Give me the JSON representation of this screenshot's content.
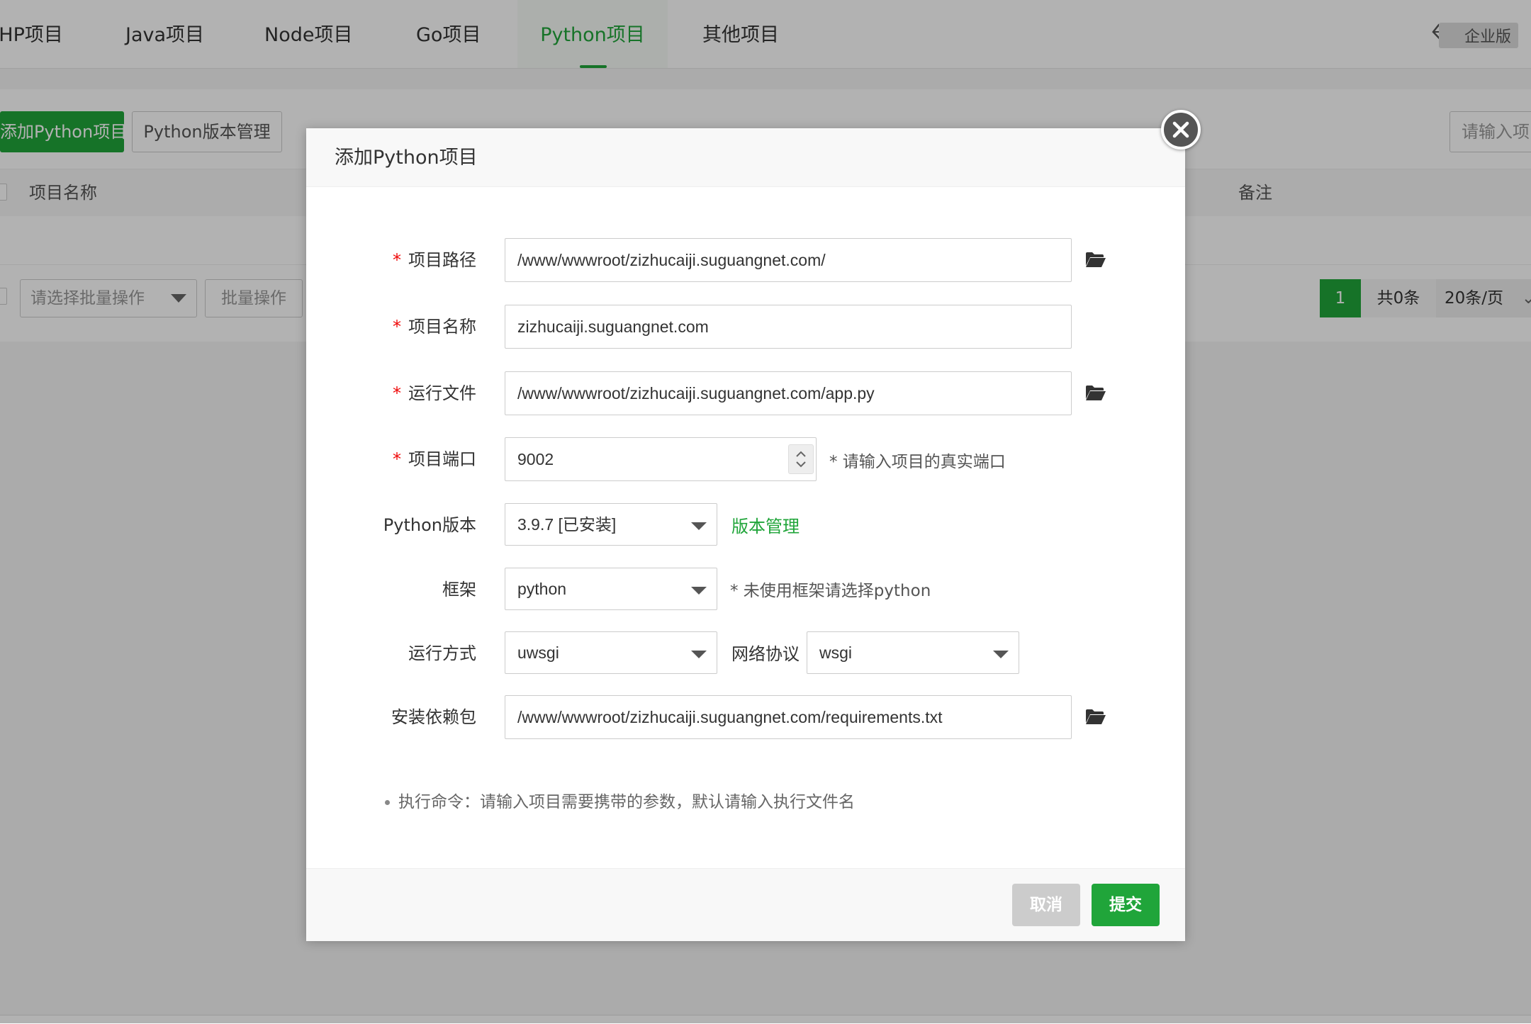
{
  "tabs": [
    {
      "label": "PHP项目",
      "active": false
    },
    {
      "label": "Java项目",
      "active": false
    },
    {
      "label": "Node项目",
      "active": false
    },
    {
      "label": "Go项目",
      "active": false
    },
    {
      "label": "Python项目",
      "active": true
    },
    {
      "label": "其他项目",
      "active": false
    }
  ],
  "enterprise_label": "企业版",
  "toolbar": {
    "add_label": "添加Python项目",
    "version_label": "Python版本管理",
    "search_placeholder": "请输入项"
  },
  "table": {
    "columns": [
      "项目名称",
      "备注"
    ],
    "batch_placeholder": "请选择批量操作",
    "batch_button": "批量操作"
  },
  "pager": {
    "current": "1",
    "total": "共0条",
    "page_size": "20条/页"
  },
  "colors": {
    "accent": "#20a53a",
    "required": "#ef0808"
  },
  "modal": {
    "title": "添加Python项目",
    "fields": {
      "path": {
        "label": "项目路径",
        "required": true,
        "value": "/www/wwwroot/zizhucaiji.suguangnet.com/"
      },
      "name": {
        "label": "项目名称",
        "required": true,
        "value": "zizhucaiji.suguangnet.com"
      },
      "run_file": {
        "label": "运行文件",
        "required": true,
        "value": "/www/wwwroot/zizhucaiji.suguangnet.com/app.py"
      },
      "port": {
        "label": "项目端口",
        "required": true,
        "value": "9002",
        "hint": "* 请输入项目的真实端口"
      },
      "python_version": {
        "label": "Python版本",
        "value": "3.9.7 [已安装]",
        "link": "版本管理"
      },
      "framework": {
        "label": "框架",
        "value": "python",
        "hint": "* 未使用框架请选择python"
      },
      "run_mode": {
        "label": "运行方式",
        "value": "uwsgi"
      },
      "protocol": {
        "label": "网络协议",
        "value": "wsgi"
      },
      "requirements": {
        "label": "安装依赖包",
        "value": "/www/wwwroot/zizhucaiji.suguangnet.com/requirements.txt"
      }
    },
    "note": "执行命令：请输入项目需要携带的参数，默认请输入执行文件名",
    "cancel_label": "取消",
    "submit_label": "提交"
  }
}
